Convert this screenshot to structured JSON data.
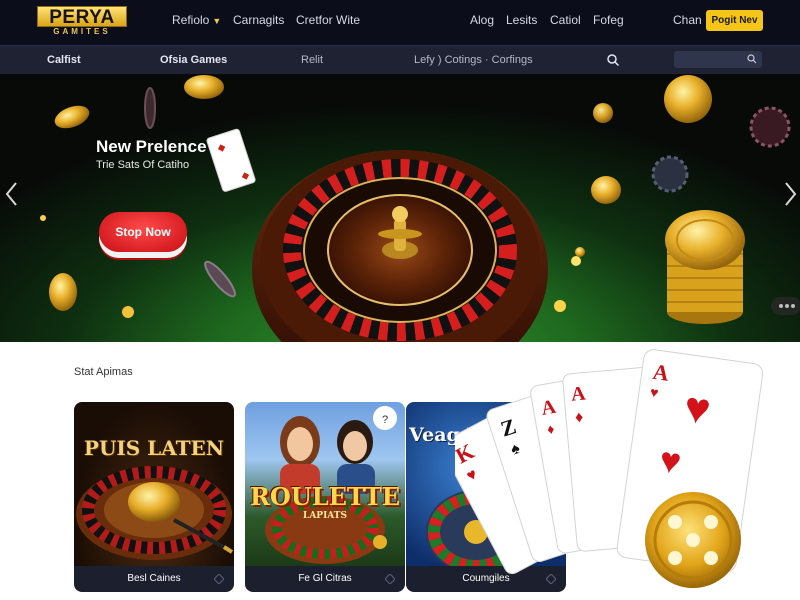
{
  "header": {
    "logo": {
      "title": "PERYA",
      "subtitle": "GAMITES"
    },
    "nav": [
      {
        "label": "Refiolo",
        "has_dropdown": true
      },
      {
        "label": "Carnagits"
      },
      {
        "label": "Cretfor Wite"
      }
    ],
    "right_links": [
      "Alog",
      "Lesits",
      "Catiol",
      "Fofeg"
    ],
    "chat_label": "Chan",
    "join_label": "Pogit Nev"
  },
  "subnav": {
    "items": [
      "Calfist",
      "Ofsia Games",
      "Relit",
      "Lefy ) Cotings · Corfings"
    ],
    "search_icon": "search-icon"
  },
  "hero": {
    "title": "New Prelence",
    "subtitle": "Trie Sats Of Catiho",
    "cta_label": "Stop Now",
    "prev_icon": "chevron-left-icon",
    "next_icon": "chevron-right-icon"
  },
  "section": {
    "title": "Stat Apimas",
    "cards": [
      {
        "art_text": "PUIS LATEN",
        "label": "Besl Caines"
      },
      {
        "art_text": "ROULETTE",
        "art_subtext": "LAPIATS",
        "label": "Fe Gl Citras"
      },
      {
        "art_text": "Veag D",
        "label": "Coumgiles"
      }
    ]
  },
  "colors": {
    "header_bg": "#0b0d1a",
    "subnav_bg": "#1e2233",
    "accent_gold": "#f5c518",
    "cta_red": "#d81a1f",
    "felt_green": "#2f8f2b"
  }
}
